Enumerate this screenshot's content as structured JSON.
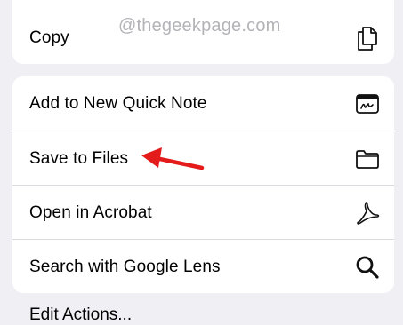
{
  "watermark": "@thegeekpage.com",
  "copy_group": {
    "copy_label": "Copy",
    "copy_icon": "copy-documents-icon"
  },
  "actions": [
    {
      "label": "Add to New Quick Note",
      "icon": "quick-note-icon"
    },
    {
      "label": "Save to Files",
      "icon": "folder-icon"
    },
    {
      "label": "Open in Acrobat",
      "icon": "acrobat-icon"
    },
    {
      "label": "Search with Google Lens",
      "icon": "magnifying-glass-icon"
    }
  ],
  "partial_item_label": "Edit Actions...",
  "annotation": {
    "arrow_color": "#e31b1b",
    "target": "Save to Files"
  }
}
